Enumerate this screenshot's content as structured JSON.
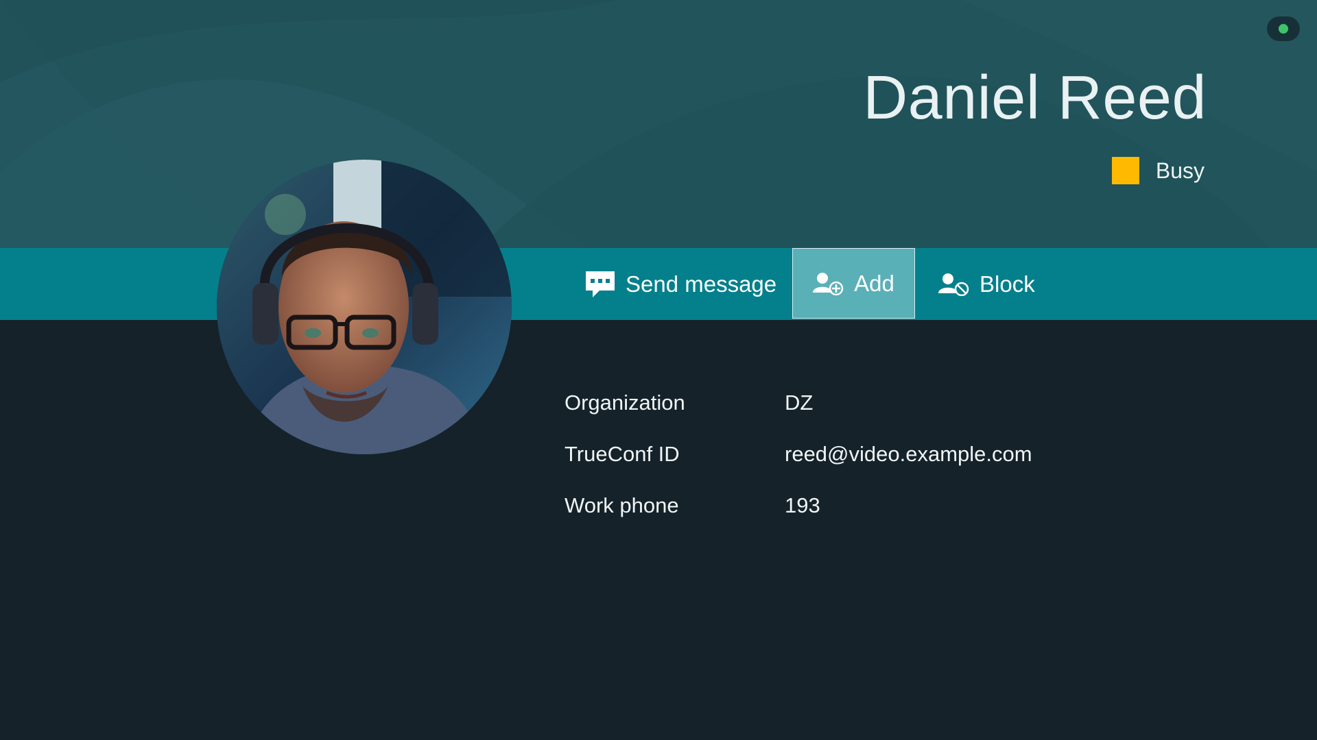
{
  "contact": {
    "name": "Daniel Reed",
    "status": {
      "label": "Busy",
      "color": "#ffba00"
    }
  },
  "connection": {
    "icon": "connection-status-icon",
    "color": "#3fc36a"
  },
  "actions": {
    "send_message": {
      "label": "Send message",
      "icon": "message-icon"
    },
    "add": {
      "label": "Add",
      "icon": "add-user-icon"
    },
    "block": {
      "label": "Block",
      "icon": "block-user-icon"
    }
  },
  "details": [
    {
      "label": "Organization",
      "value": "DZ"
    },
    {
      "label": "TrueConf ID",
      "value": "reed@video.example.com"
    },
    {
      "label": "Work phone",
      "value": "193"
    }
  ],
  "colors": {
    "header_bg": "#22545c",
    "action_bar_bg": "#04808c",
    "selected_action_bg": "#5ab0b7",
    "page_bg": "#15222a"
  }
}
